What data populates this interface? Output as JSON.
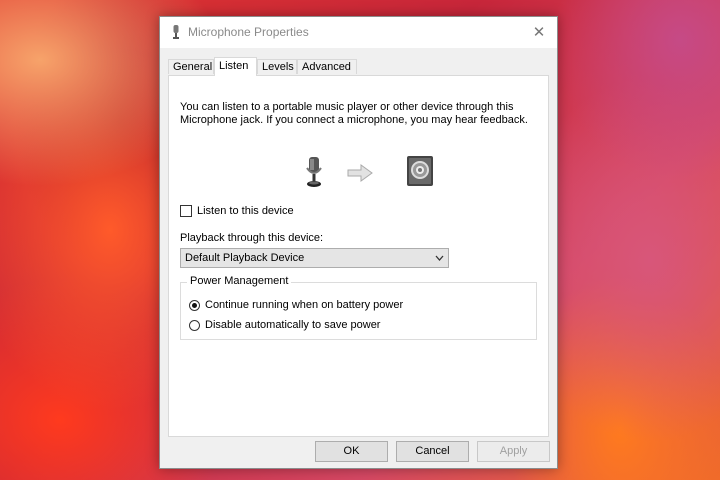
{
  "window": {
    "title": "Microphone Properties",
    "close_glyph": "✕"
  },
  "tabs": [
    {
      "label": "General",
      "active": false
    },
    {
      "label": "Listen",
      "active": true
    },
    {
      "label": "Levels",
      "active": false
    },
    {
      "label": "Advanced",
      "active": false
    }
  ],
  "listen": {
    "description": "You can listen to a portable music player or other device through this Microphone jack.  If you connect a microphone, you may hear feedback.",
    "icons": [
      "microphone-icon",
      "arrow-right-icon",
      "speaker-icon"
    ],
    "listen_checkbox": {
      "label": "Listen to this device",
      "checked": false
    },
    "playback_label": "Playback through this device:",
    "playback_select": {
      "value": "Default Playback Device"
    },
    "power_group": {
      "legend": "Power Management",
      "options": [
        {
          "label": "Continue running when on battery power",
          "checked": true
        },
        {
          "label": "Disable automatically to save power",
          "checked": false
        }
      ]
    }
  },
  "buttons": {
    "ok": "OK",
    "cancel": "Cancel",
    "apply": "Apply"
  }
}
